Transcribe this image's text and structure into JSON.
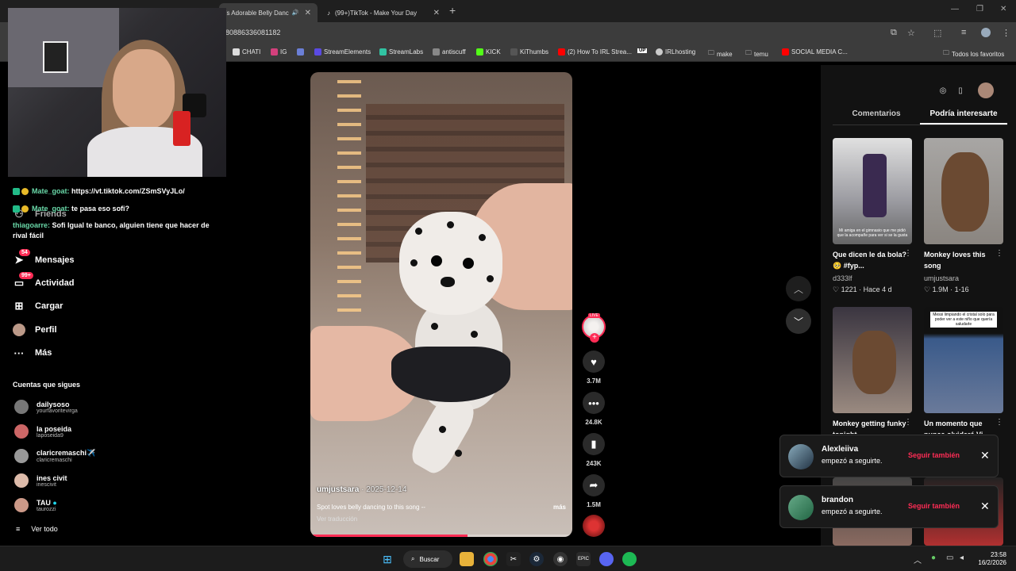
{
  "browser": {
    "tabs": [
      {
        "title": "'s Adorable Belly Danc",
        "sound": "🔊"
      },
      {
        "title": "(99+)TikTok - Make Your Day"
      }
    ],
    "url": "80886336081182",
    "bookmarks": [
      "CHATI",
      "IG",
      "StreamElements",
      "StreamLabs",
      "antiscuff",
      "KICK",
      "KiThumbs",
      "(2) How To IRL Strea...",
      "IRLhosting",
      "make",
      "temu",
      "SOCIAL MEDIA C..."
    ],
    "bookmarks_right": "Todos los favoritos"
  },
  "chat": [
    {
      "user": "Mate_goat:",
      "text": "https://vt.tiktok.com/ZSmSVyJLo/"
    },
    {
      "user": "Mate_goat:",
      "text": "te pasa eso sofi?"
    },
    {
      "user": "thiagoarre:",
      "text": "Sofi Igual te banco, alguien tiene que hacer de"
    },
    {
      "user": "",
      "text": "rival fácil"
    }
  ],
  "nav": [
    {
      "label": "Friends",
      "icon": "friends-icon"
    },
    {
      "label": "Mensajes",
      "icon": "messages-icon",
      "badge": "54"
    },
    {
      "label": "Actividad",
      "icon": "activity-icon",
      "badge": "99+"
    },
    {
      "label": "Cargar",
      "icon": "upload-icon"
    },
    {
      "label": "Perfil",
      "icon": "profile-icon"
    },
    {
      "label": "Más",
      "icon": "more-icon"
    }
  ],
  "following": {
    "title": "Cuentas que sigues",
    "accounts": [
      {
        "name": "dailysoso",
        "handle": "yourfavoritevirga"
      },
      {
        "name": "la poseida",
        "handle": "laposeida9"
      },
      {
        "name": "claricremaschi✈️",
        "handle": "claricremaschi"
      },
      {
        "name": "ines civit",
        "handle": "inescivit"
      },
      {
        "name": "TAU",
        "handle": "taurozzi"
      }
    ],
    "see_all": "Ver todo"
  },
  "video": {
    "username": "umjustsara",
    "date": "· 2025-12-14",
    "description": "Spot loves belly dancing to this song --",
    "more": "más",
    "translate": "Ver traducción",
    "progress": 0.6,
    "likes": "3.7M",
    "comments": "24.8K",
    "saves": "243K",
    "shares": "1.5M",
    "live": "LIVE"
  },
  "right_panel": {
    "tabs": [
      "Comentarios",
      "Podría interesarte"
    ],
    "items": [
      {
        "caption": "Que dicen le da bola?🥺 #fyp...",
        "user": "d333lf",
        "stats": "♡ 1221 · Hace 4 d",
        "overlay": "Mi amiga en el gimnasio que me pidió que la acompañe para ver si se la gusta"
      },
      {
        "caption": "Monkey loves this song",
        "user": "umjustsara",
        "stats": "♡ 1.9M · 1-16",
        "overlay": ""
      },
      {
        "caption": "Monkey getting funky tonight",
        "user": "",
        "stats": "",
        "overlay": ""
      },
      {
        "caption": "Un momento que nunca olvidaré Vi",
        "user": "",
        "stats": "",
        "overlay": "Messi limpiando el cristal solo para poder ver a este niño que quería saludarle"
      }
    ]
  },
  "notifications": [
    {
      "name": "Alexleiiva",
      "message": "empezó a seguirte.",
      "action": "Seguir también"
    },
    {
      "name": "brandon",
      "message": "empezó a seguirte.",
      "action": "Seguir también"
    }
  ],
  "taskbar": {
    "search": "Buscar",
    "time": "23:58",
    "date": "16/2/2026"
  }
}
